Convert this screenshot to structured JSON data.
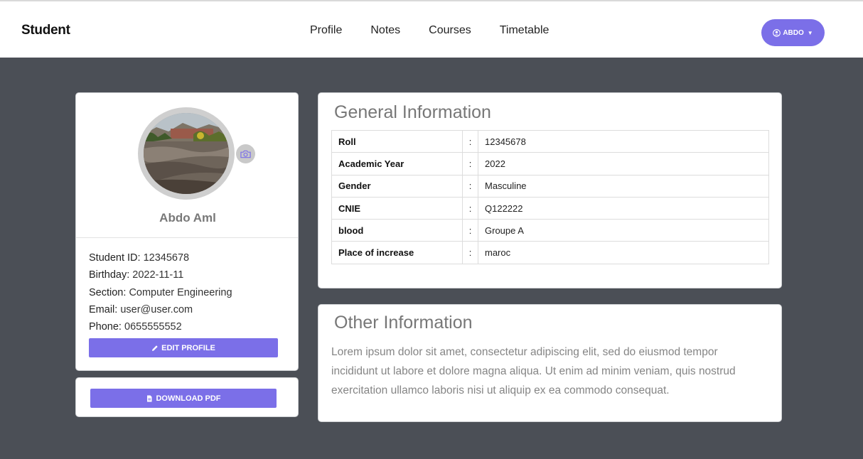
{
  "header": {
    "brand": "Student",
    "nav": [
      "Profile",
      "Notes",
      "Courses",
      "Timetable"
    ],
    "user_label": "ABDO",
    "user_icon": "user-circle-icon"
  },
  "profile": {
    "name": "Abdo Aml",
    "avatar_icon": "landscape-photo",
    "camera_icon": "camera-icon",
    "fields": [
      {
        "label": "Student ID:",
        "value": "12345678"
      },
      {
        "label": "Birthday:",
        "value": "2022-11-11"
      },
      {
        "label": "Section:",
        "value": "Computer Engineering"
      },
      {
        "label": "Email:",
        "value": "user@user.com"
      },
      {
        "label": "Phone:",
        "value": "0655555552"
      }
    ],
    "edit_button": "EDIT PROFILE",
    "download_button": "DOWNLOAD PDF"
  },
  "general": {
    "title": "General Information",
    "separator": ":",
    "rows": [
      {
        "key": "Roll",
        "value": "12345678"
      },
      {
        "key": "Academic Year",
        "value": "2022"
      },
      {
        "key": "Gender",
        "value": "Masculine"
      },
      {
        "key": "CNIE",
        "value": "Q122222"
      },
      {
        "key": "blood",
        "value": "Groupe A"
      },
      {
        "key": "Place of increase",
        "value": "maroc"
      }
    ]
  },
  "other": {
    "title": "Other Information",
    "text": "Lorem ipsum dolor sit amet, consectetur adipiscing elit, sed do eiusmod tempor incididunt ut labore et dolore magna aliqua. Ut enim ad minim veniam, quis nostrud exercitation ullamco laboris nisi ut aliquip ex ea commodo consequat."
  },
  "colors": {
    "accent": "#7b6fe8",
    "background": "#4b4f56"
  }
}
